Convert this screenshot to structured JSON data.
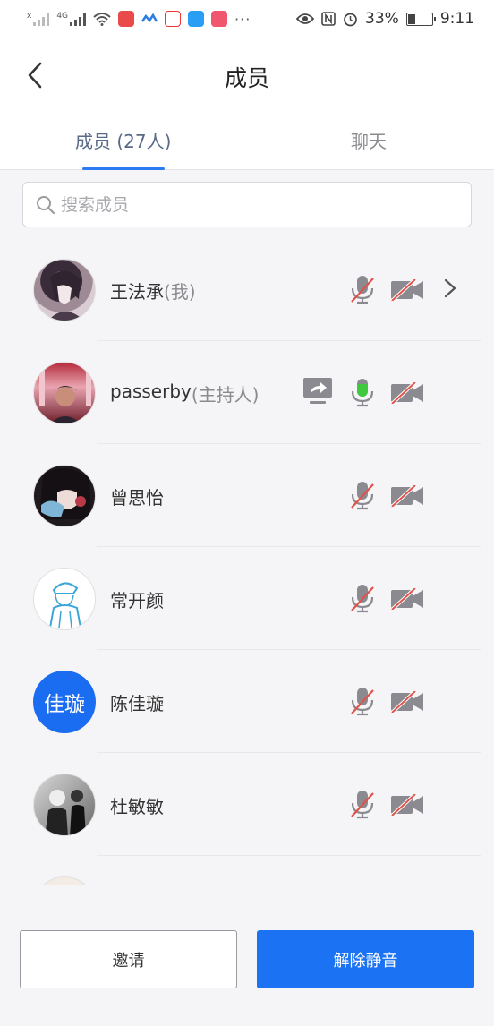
{
  "status_bar": {
    "net_label_1": "x",
    "net_label_2": "4G",
    "battery": "33%",
    "time": "9:11",
    "more": "···"
  },
  "header": {
    "title": "成员"
  },
  "tabs": [
    {
      "label": "成员 (27人)",
      "active": true
    },
    {
      "label": "聊天",
      "active": false
    }
  ],
  "search": {
    "placeholder": "搜索成员",
    "value": ""
  },
  "members": [
    {
      "name": "王法承",
      "role": "(我)",
      "mic": "muted",
      "camera": "off",
      "has_chevron": true
    },
    {
      "name": "passerby",
      "role": "(主持人)",
      "mic": "active",
      "camera": "off",
      "sharing": true
    },
    {
      "name": "曾思怡",
      "role": "",
      "mic": "muted",
      "camera": "off"
    },
    {
      "name": "常开颜",
      "role": "",
      "mic": "muted",
      "camera": "off"
    },
    {
      "name": "陈佳璇",
      "role": "",
      "mic": "muted",
      "camera": "off",
      "avatar_text": "佳璇"
    },
    {
      "name": "杜敏敏",
      "role": "",
      "mic": "muted",
      "camera": "off"
    }
  ],
  "actions": {
    "invite_label": "邀请",
    "unmute_label": "解除静音"
  },
  "colors": {
    "accent": "#1b72f3",
    "tab_underline": "#2d7bf4",
    "mic_active": "#3ec93e",
    "muted_slash": "#e0524a",
    "icon_gray": "#888888"
  },
  "icons": {
    "back": "chevron-left-icon",
    "search": "search-icon",
    "mic": "microphone-icon",
    "camera": "camera-icon",
    "share": "screen-share-icon",
    "chevron": "chevron-right-icon"
  }
}
